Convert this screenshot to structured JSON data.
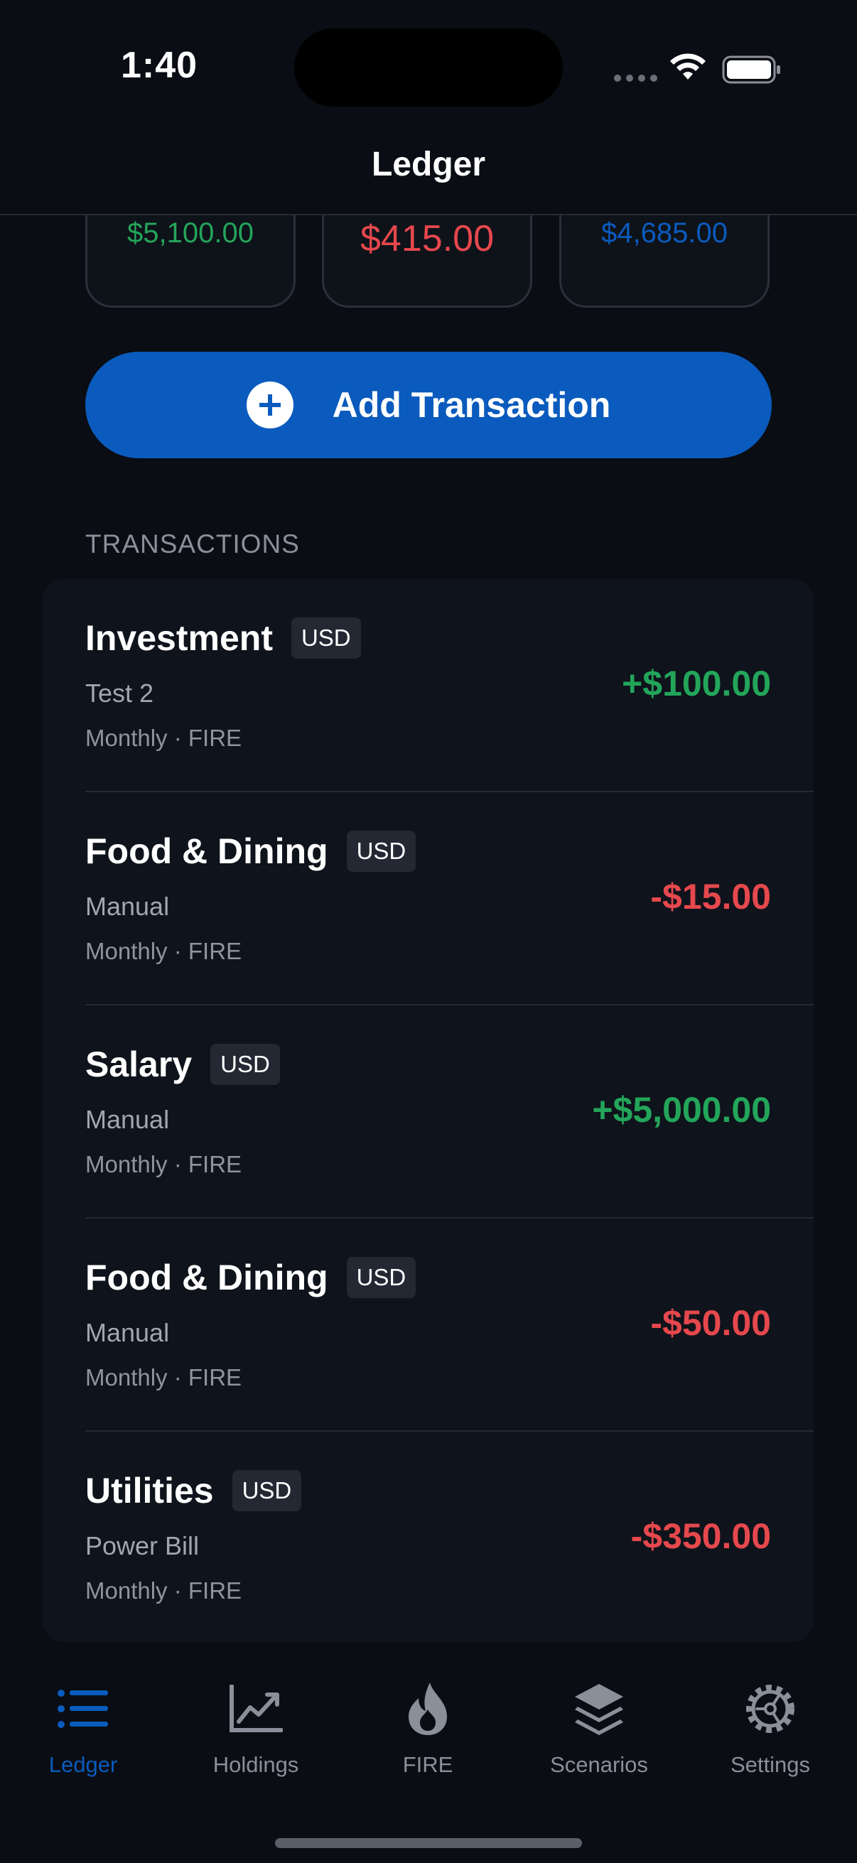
{
  "status_bar": {
    "time": "1:40"
  },
  "nav": {
    "title": "Ledger"
  },
  "summary": [
    {
      "value": "$5,100.00",
      "color": "#23a55a"
    },
    {
      "value": "$415.00",
      "color": "#e5484d"
    },
    {
      "value": "$4,685.00",
      "color": "#0a5bbd"
    }
  ],
  "add_button": {
    "label": "Add Transaction"
  },
  "transactions": {
    "header": "TRANSACTIONS",
    "items": [
      {
        "category": "Investment",
        "currency": "USD",
        "description": "Test 2",
        "meta": "Monthly · FIRE",
        "amount": "+$100.00",
        "amount_color": "#23a55a"
      },
      {
        "category": "Food & Dining",
        "currency": "USD",
        "description": "Manual",
        "meta": "Monthly · FIRE",
        "amount": "-$15.00",
        "amount_color": "#e5484d"
      },
      {
        "category": "Salary",
        "currency": "USD",
        "description": "Manual",
        "meta": "Monthly · FIRE",
        "amount": "+$5,000.00",
        "amount_color": "#23a55a"
      },
      {
        "category": "Food & Dining",
        "currency": "USD",
        "description": "Manual",
        "meta": "Monthly · FIRE",
        "amount": "-$50.00",
        "amount_color": "#e5484d"
      },
      {
        "category": "Utilities",
        "currency": "USD",
        "description": "Power Bill",
        "meta": "Monthly · FIRE",
        "amount": "-$350.00",
        "amount_color": "#e5484d"
      }
    ]
  },
  "tab_bar": {
    "tabs": [
      {
        "label": "Ledger",
        "icon": "list-icon",
        "active": true
      },
      {
        "label": "Holdings",
        "icon": "chart-line-icon",
        "active": false
      },
      {
        "label": "FIRE",
        "icon": "flame-icon",
        "active": false
      },
      {
        "label": "Scenarios",
        "icon": "layers-icon",
        "active": false
      },
      {
        "label": "Settings",
        "icon": "gear-icon",
        "active": false
      }
    ]
  },
  "colors": {
    "accent": "#0a5bbd",
    "positive": "#23a55a",
    "negative": "#e5484d"
  }
}
